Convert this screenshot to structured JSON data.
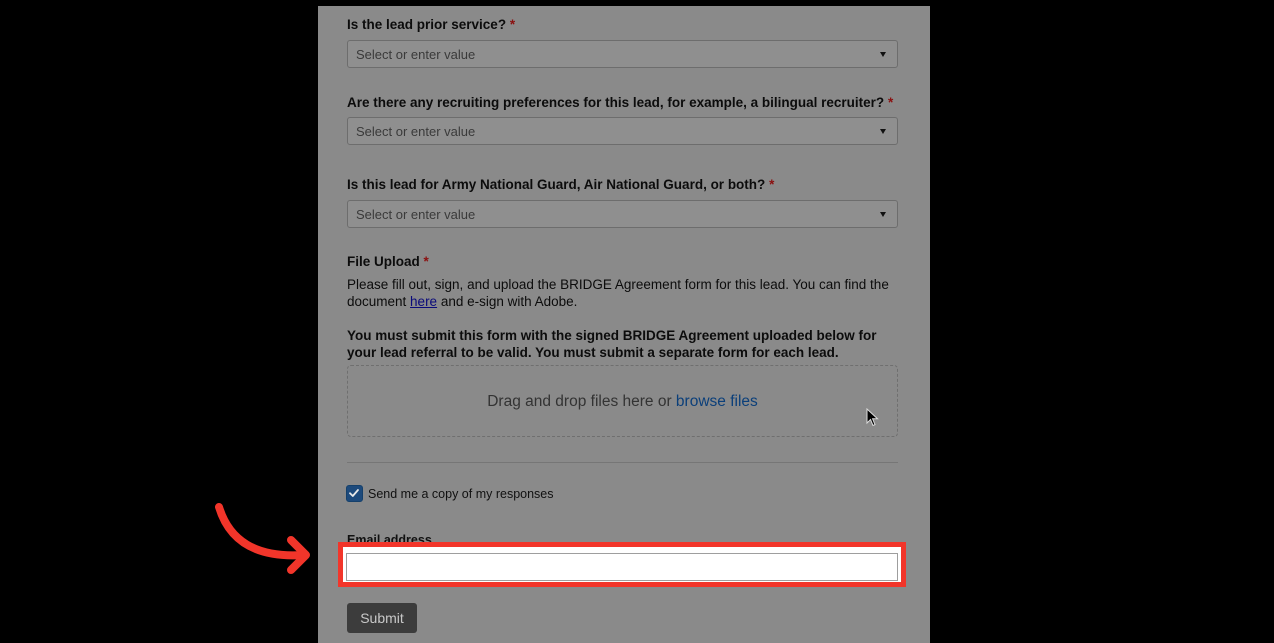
{
  "form": {
    "required_marker": "*",
    "questions": [
      {
        "label": "Is the lead prior service?",
        "placeholder": "Select or enter value"
      },
      {
        "label": "Are there any recruiting preferences for this lead, for example, a bilingual recruiter?",
        "placeholder": "Select or enter value"
      },
      {
        "label": "Is this lead for Army National Guard, Air National Guard, or both?",
        "placeholder": "Select or enter value"
      }
    ],
    "file_upload": {
      "label": "File Upload",
      "desc_before_link": "Please fill out, sign, and upload the BRIDGE Agreement form for this lead. You can find the document ",
      "link_text": "here",
      "desc_after_link": " and e-sign with Adobe.",
      "notice": "You must submit this form with the signed BRIDGE Agreement uploaded below for your lead referral to be valid. You must submit a separate form for each lead.",
      "drop_text": "Drag and drop files here or ",
      "browse_text": "browse files"
    },
    "copy_checkbox": {
      "label": "Send me a copy of my responses",
      "checked": true
    },
    "email": {
      "label": "Email address",
      "value": ""
    },
    "submit_label": "Submit"
  },
  "annotation": {
    "highlight_color": "#f2352a",
    "arrow_color": "#f2352a"
  }
}
